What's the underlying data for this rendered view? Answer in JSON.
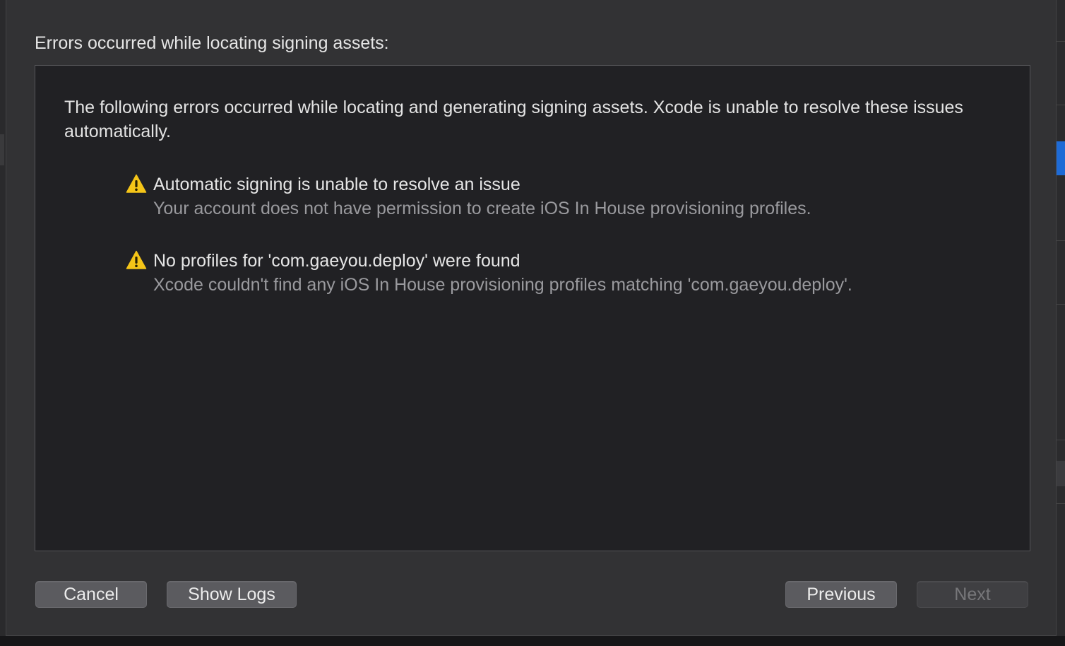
{
  "dialog": {
    "title": "Errors occurred while locating signing assets:",
    "intro": "The following errors occurred while locating and generating signing assets. Xcode is unable to resolve these issues automatically.",
    "issues": [
      {
        "icon": "warning-icon",
        "title": "Automatic signing is unable to resolve an issue",
        "detail": "Your account does not have permission to create iOS In House provisioning profiles."
      },
      {
        "icon": "warning-icon",
        "title": "No profiles for 'com.gaeyou.deploy' were found",
        "detail": "Xcode couldn't find any iOS In House provisioning profiles matching 'com.gaeyou.deploy'."
      }
    ]
  },
  "buttons": {
    "cancel": "Cancel",
    "show_logs": "Show Logs",
    "previous": "Previous",
    "next": "Next"
  },
  "colors": {
    "sheet_background": "#323234",
    "panel_background": "#212124",
    "warning_yellow": "#f5c518",
    "button_background": "#5b5b5f",
    "disabled_text": "#77777a"
  }
}
